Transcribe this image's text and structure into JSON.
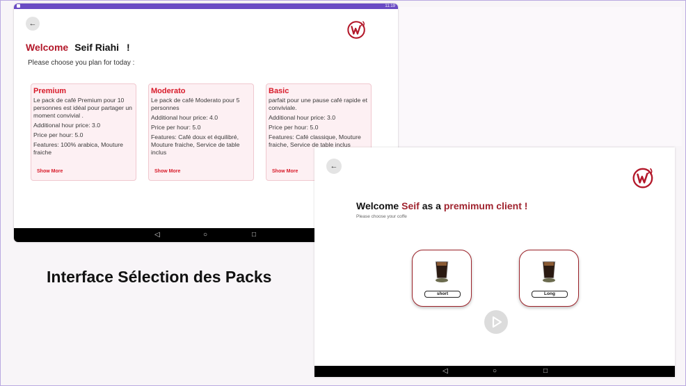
{
  "screen1": {
    "status_time": "11:19",
    "welcome_word": "Welcome",
    "user_name": "Seif Riahi",
    "exclaim": "!",
    "subtitle": "Please choose you plan for today :",
    "plans": [
      {
        "name": "Premium",
        "description": "Le pack de café Premium pour 10 personnes est idéal pour partager un moment convivial  .",
        "additional": "Additional hour price: 3.0",
        "price": "Price per hour: 5.0",
        "features": "Features: 100% arabica, Mouture fraiche",
        "more": "Show More"
      },
      {
        "name": "Moderato",
        "description": "Le pack de café Moderato pour 5 personnes",
        "additional": "Additional hour price: 4.0",
        "price": "Price per hour: 5.0",
        "features": "Features: Café doux et équilibré, Mouture fraiche, Service de table inclus",
        "more": "Show More"
      },
      {
        "name": "Basic",
        "description": " parfait pour une pause café rapide et conviviale.",
        "additional": "Additional hour price: 3.0",
        "price": "Price per hour: 5.0",
        "features": "Features: Café classique, Mouture fraiche, Service de table inclus",
        "more": "Show More"
      }
    ],
    "nav": {
      "back": "◁",
      "home": "○",
      "recents": "□"
    }
  },
  "caption": "Interface Sélection des Packs",
  "screen2": {
    "welcome_word": "Welcome",
    "user_name": "Seif",
    "as_a": "as a",
    "client_type": "premimum client !",
    "subtitle": "Please choose your coffe",
    "coffees": [
      {
        "label": "short"
      },
      {
        "label": "Long"
      }
    ],
    "nav": {
      "back": "◁",
      "home": "○",
      "recents": "□"
    }
  },
  "icons": {
    "back": "arrow-left-icon",
    "logo": "wifi-coffee-logo",
    "play": "play-icon",
    "coffee": "coffee-cup-icon"
  },
  "colors": {
    "accent_red": "#d81a29",
    "dark_red": "#9b2128",
    "status_bar": "#6a4bc4"
  }
}
